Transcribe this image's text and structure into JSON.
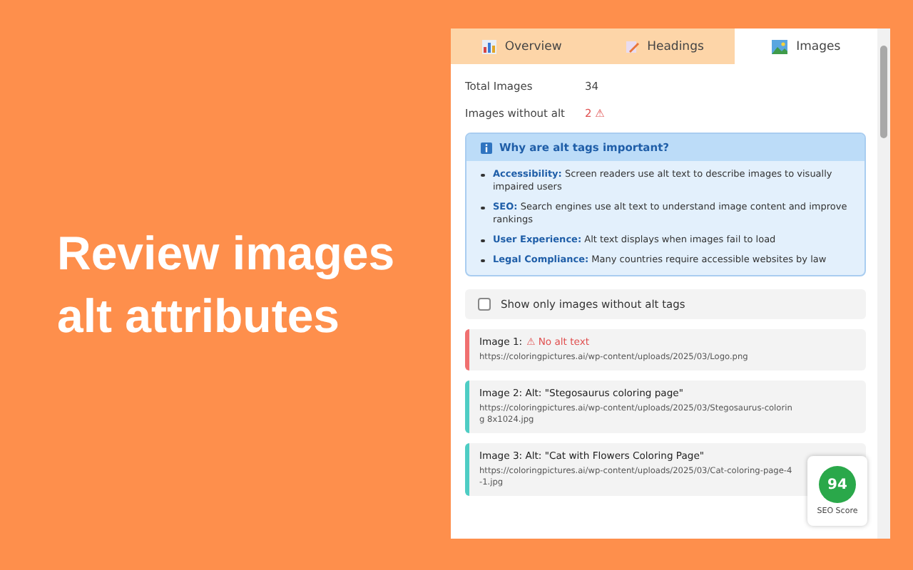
{
  "headline": "Review images alt attributes",
  "tabs": [
    {
      "label": "Overview",
      "kind": "chart",
      "selected": false
    },
    {
      "label": "Headings",
      "kind": "pencil",
      "selected": false
    },
    {
      "label": "Images",
      "kind": "picture",
      "selected": true
    }
  ],
  "stats": [
    {
      "label": "Total Images",
      "value": "34",
      "kind": "plain"
    },
    {
      "label": "Images without alt",
      "value": "2 ⚠",
      "kind": "warning"
    }
  ],
  "info": {
    "title": "Why are alt tags important?",
    "items": [
      "**Accessibility:** Screen readers use alt text to describe images to visually impaired users",
      "**SEO:** Search engines use alt text to understand image content and improve rankings",
      "**User Experience:** Alt text displays when images fail to load",
      "**Legal Compliance:** Many countries require accessible websites by law"
    ]
  },
  "filter": {
    "label": "Show only images without alt tags",
    "checked": false
  },
  "images": [
    {
      "kind": "missing",
      "title": "Image 1:",
      "note": "⚠ No alt text",
      "url": "https://coloringpictures.ai/wp-content/uploads/2025/03/Logo.png"
    },
    {
      "kind": "alt",
      "title": "Image 2: Alt: \"Stegosaurus coloring page\"",
      "url": "https://coloringpictures.ai/wp-content/uploads/2025/03/Stegosaurus-coloring 8x1024.jpg"
    },
    {
      "kind": "alt",
      "title": "Image 3: Alt: \"Cat with Flowers Coloring Page\"",
      "url": "https://coloringpictures.ai/wp-content/uploads/2025/03/Cat-coloring-page-4-1.jpg"
    }
  ],
  "seo": {
    "score": "94",
    "label": "SEO Score"
  }
}
